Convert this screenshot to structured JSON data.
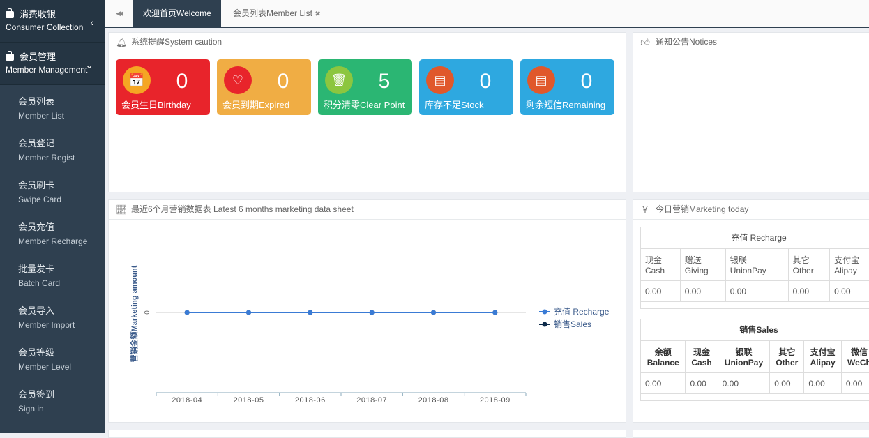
{
  "sidebar": {
    "groups": [
      {
        "zh": "消费收银",
        "en": "Consumer Collection",
        "chevron": "‹"
      },
      {
        "zh": "会员管理",
        "en": "Member Management",
        "chevron": "⌄"
      }
    ],
    "items": [
      {
        "zh": "会员列表",
        "en": "Member List"
      },
      {
        "zh": "会员登记",
        "en": "Member Regist"
      },
      {
        "zh": "会员刷卡",
        "en": "Swipe Card"
      },
      {
        "zh": "会员充值",
        "en": "Member Recharge"
      },
      {
        "zh": "批量发卡",
        "en": "Batch Card"
      },
      {
        "zh": "会员导入",
        "en": "Member Import"
      },
      {
        "zh": "会员等级",
        "en": "Member Level"
      },
      {
        "zh": "会员签到",
        "en": "Sign in"
      }
    ]
  },
  "tabs": {
    "back": "◀◀",
    "active": "欢迎首页Welcome",
    "other": "会员列表Member List",
    "close": "✖"
  },
  "caution": {
    "title": "系统提醒System caution",
    "cards": [
      {
        "value": "0",
        "label": "会员生日Birthday",
        "color": "#e8242b",
        "circle": "#f5a623",
        "icon": "calendar-icon",
        "glyph": "📅"
      },
      {
        "value": "0",
        "label": "会员到期Expired",
        "color": "#f0ad44",
        "circle": "#e8242b",
        "icon": "heart-icon",
        "glyph": "♡"
      },
      {
        "value": "5",
        "label": "积分清零Clear Point",
        "color": "#2bb673",
        "circle": "#8cc63f",
        "icon": "trash-icon",
        "glyph": "🗑"
      },
      {
        "value": "0",
        "label": "库存不足Stock",
        "color": "#2ea8e0",
        "circle": "#e0582b",
        "icon": "drawer-icon",
        "glyph": "▤"
      },
      {
        "value": "0",
        "label": "剩余短信Remaining",
        "color": "#2ea8e0",
        "circle": "#e0582b",
        "icon": "drawer-icon",
        "glyph": "▤"
      }
    ]
  },
  "notices": {
    "title": "通知公告Notices"
  },
  "marketing_chart": {
    "title": "最近6个月营销数据表 Latest 6 months marketing data sheet"
  },
  "today": {
    "title": "今日营销Marketing today",
    "recharge": {
      "title": "充值 Recharge",
      "headers": [
        [
          "现金",
          "Cash"
        ],
        [
          "赠送",
          "Giving"
        ],
        [
          "银联",
          "UnionPay"
        ],
        [
          "其它",
          "Other"
        ],
        [
          "支付宝",
          "Alipay"
        ]
      ],
      "values": [
        "0.00",
        "0.00",
        "0.00",
        "0.00",
        "0.00"
      ]
    },
    "sales": {
      "title": "销售Sales",
      "headers": [
        [
          "余额",
          "Balance"
        ],
        [
          "现金",
          "Cash"
        ],
        [
          "银联",
          "UnionPay"
        ],
        [
          "其它",
          "Other"
        ],
        [
          "支付宝",
          "Alipay"
        ],
        [
          "微信",
          "WeCh"
        ]
      ],
      "values": [
        "0.00",
        "0.00",
        "0.00",
        "0.00",
        "0.00",
        "0.00"
      ]
    }
  },
  "chart_data": {
    "type": "line",
    "categories": [
      "2018-04",
      "2018-05",
      "2018-06",
      "2018-07",
      "2018-08",
      "2018-09"
    ],
    "series": [
      {
        "name": "充值 Recharge",
        "values": [
          0,
          0,
          0,
          0,
          0,
          0
        ],
        "color": "#3a7bd5"
      },
      {
        "name": "销售Sales",
        "values": [
          0,
          0,
          0,
          0,
          0,
          0
        ],
        "color": "#0d2a4a"
      }
    ],
    "ylabel": "营销金额Marketing amount",
    "yticks": [
      "0"
    ],
    "legend": "right"
  }
}
